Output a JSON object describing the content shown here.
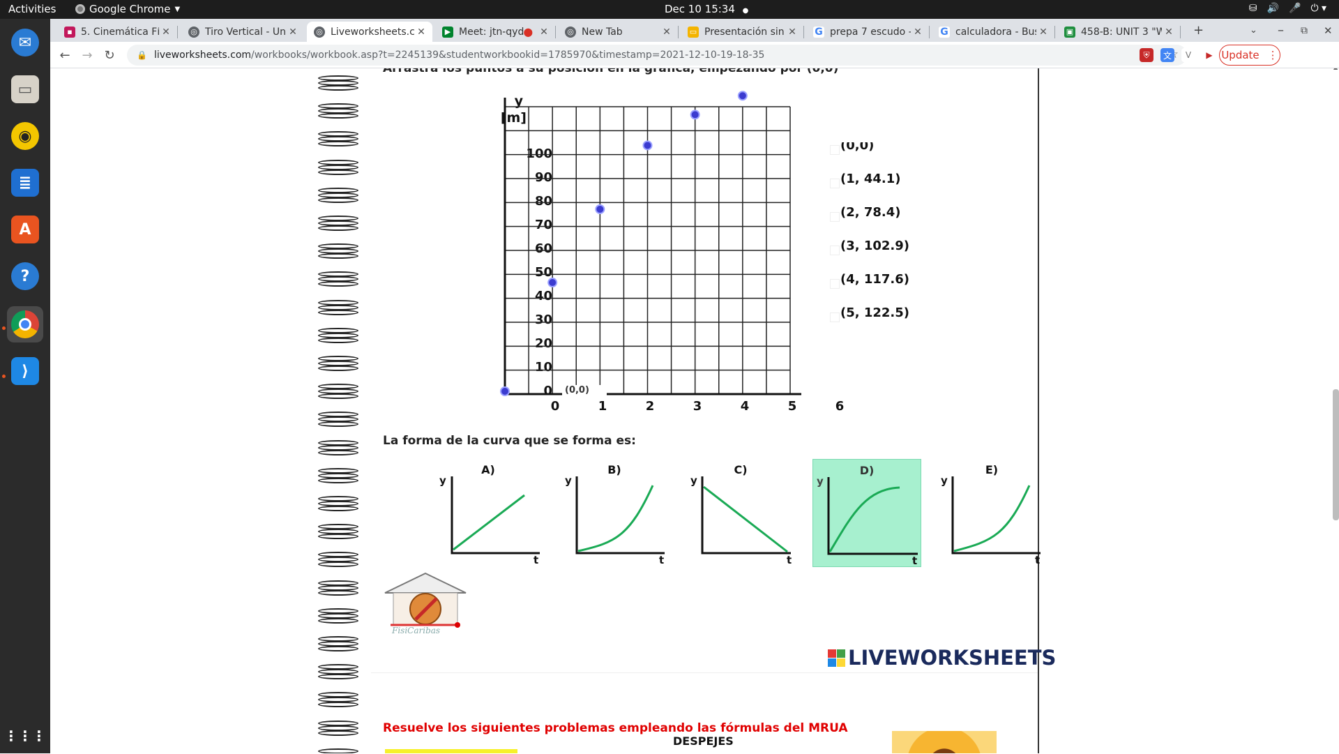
{
  "topbar": {
    "activities": "Activities",
    "app_name": "Google Chrome",
    "clock": "Dec 10  15:34"
  },
  "dock": {
    "apps": [
      "thunderbird-icon",
      "files-icon",
      "rhythmbox-icon",
      "writer-icon",
      "software-icon",
      "help-icon",
      "chrome-icon",
      "vscode-icon",
      "app-grid-icon"
    ]
  },
  "tabs": [
    {
      "title": "5. Cinemática Fís",
      "favicon_color": "#c2185b"
    },
    {
      "title": "Tiro Vertical - Uni",
      "favicon_color": "#5f6368"
    },
    {
      "title": "Liveworksheets.c",
      "favicon_color": "#5f6368"
    },
    {
      "title": "Meet: jtn-qyd",
      "favicon_color": "#00832d"
    },
    {
      "title": "New Tab",
      "favicon_color": "#5f6368"
    },
    {
      "title": "Presentación sin",
      "favicon_color": "#f4b400"
    },
    {
      "title": "prepa 7 escudo -",
      "favicon_color": "#4285f4"
    },
    {
      "title": "calculadora - Bus",
      "favicon_color": "#4285f4"
    },
    {
      "title": "458-B: UNIT 3 \"W",
      "favicon_color": "#1e8e3e"
    }
  ],
  "address": {
    "host": "liveworksheets.com",
    "path": "/workbooks/workbook.asp?t=2245139&studentworkbookid=1785970&timestamp=2021-12-10-19-18-35"
  },
  "update_label": "Update",
  "worksheet": {
    "instruction": "Arrastra los puntos a su posición en la gráfica, empezando por (0,0)",
    "y_label_1": "y",
    "y_label_2": "[m]",
    "y_ticks": [
      "100",
      "90",
      "80",
      "70",
      "60",
      "50",
      "40",
      "30",
      "20",
      "10",
      "0"
    ],
    "x_ticks": [
      "0",
      "1",
      "2",
      "3",
      "4",
      "5",
      "6"
    ],
    "origin_tag": "(0,0)",
    "coordinates": [
      "(0,0)",
      "(1, 44.1)",
      "(2, 78.4)",
      "(3, 102.9)",
      "(4, 117.6)",
      "(5, 122.5)"
    ],
    "curve_question": "La forma de la curva que se forma es:",
    "options": [
      {
        "label": "A)",
        "shape": "linear-increasing"
      },
      {
        "label": "B)",
        "shape": "exponential-increasing"
      },
      {
        "label": "C)",
        "shape": "linear-decreasing"
      },
      {
        "label": "D)",
        "shape": "concave-saturating",
        "selected": true
      },
      {
        "label": "E)",
        "shape": "exponential-increasing"
      }
    ],
    "axis_y": "y",
    "axis_t": "t",
    "brand": "LIVEWORKSHEETS",
    "brand_mark": "LIVE",
    "mrua_heading": "Resuelve los siguientes problemas empleando las fórmulas del MRUA",
    "despejes": "DESPEJES"
  },
  "chart_data": {
    "type": "scatter",
    "title": "",
    "xlabel": "",
    "ylabel": "y [m]",
    "xlim": [
      0,
      6
    ],
    "ylim": [
      0,
      100
    ],
    "grid": true,
    "x": [
      0,
      1,
      2,
      3,
      4,
      5
    ],
    "y": [
      0,
      46,
      77,
      104,
      117,
      125
    ],
    "point_color": "#3b3bd0"
  }
}
